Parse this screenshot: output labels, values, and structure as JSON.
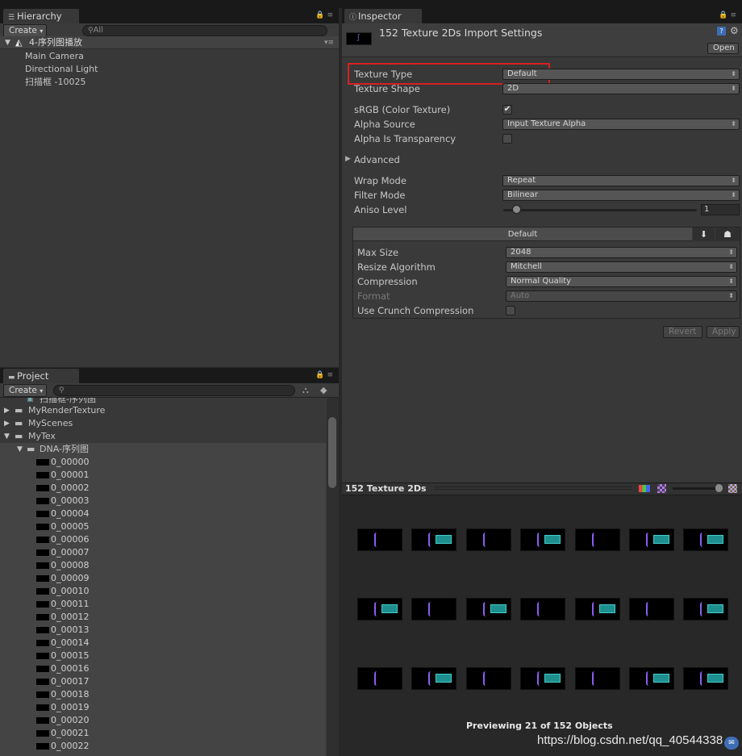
{
  "hierarchy": {
    "tab_label": "Hierarchy",
    "create_label": "Create",
    "search_placeholder": "All",
    "scene_name": "4-序列图播放",
    "items": [
      "Main Camera",
      "Directional Light",
      "扫描框 -10025"
    ]
  },
  "project": {
    "tab_label": "Project",
    "create_label": "Create",
    "partial_item": "扫描框-序列图",
    "folders": [
      "MyRenderTexture",
      "MyScenes",
      "MyTex"
    ],
    "subfolder": "DNA-序列图",
    "files": [
      "0_00000",
      "0_00001",
      "0_00002",
      "0_00003",
      "0_00004",
      "0_00005",
      "0_00006",
      "0_00007",
      "0_00008",
      "0_00009",
      "0_00010",
      "0_00011",
      "0_00012",
      "0_00013",
      "0_00014",
      "0_00015",
      "0_00016",
      "0_00017",
      "0_00018",
      "0_00019",
      "0_00020",
      "0_00021",
      "0_00022"
    ]
  },
  "inspector": {
    "tab_label": "Inspector",
    "title": "152 Texture 2Ds Import Settings",
    "open_label": "Open",
    "texture_type_label": "Texture Type",
    "texture_type_value": "Default",
    "texture_shape_label": "Texture Shape",
    "texture_shape_value": "2D",
    "srgb_label": "sRGB (Color Texture)",
    "alpha_source_label": "Alpha Source",
    "alpha_source_value": "Input Texture Alpha",
    "alpha_transparency_label": "Alpha Is Transparency",
    "advanced_label": "Advanced",
    "wrap_mode_label": "Wrap Mode",
    "wrap_mode_value": "Repeat",
    "filter_mode_label": "Filter Mode",
    "filter_mode_value": "Bilinear",
    "aniso_label": "Aniso Level",
    "aniso_value": "1",
    "platform_tab_label": "Default",
    "max_size_label": "Max Size",
    "max_size_value": "2048",
    "resize_label": "Resize Algorithm",
    "resize_value": "Mitchell",
    "compression_label": "Compression",
    "compression_value": "Normal Quality",
    "format_label": "Format",
    "format_value": "Auto",
    "crunch_label": "Use Crunch Compression",
    "revert_label": "Revert",
    "apply_label": "Apply"
  },
  "preview": {
    "title": "152 Texture 2Ds",
    "footer": "Previewing 21 of 152 Objects"
  },
  "watermark": "https://blog.csdn.net/qq_40544338",
  "colors": {
    "highlight_box": "#d62020",
    "accent_blue": "#3d6db5"
  }
}
